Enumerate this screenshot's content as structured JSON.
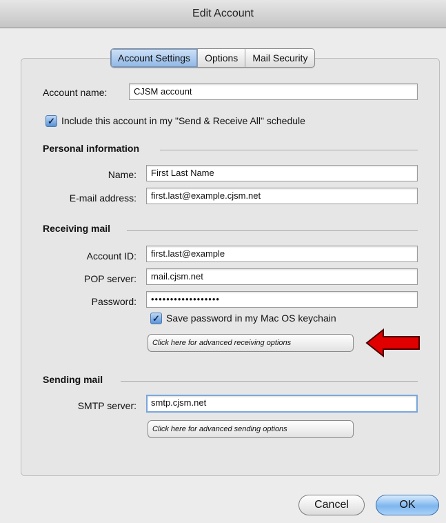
{
  "window": {
    "title": "Edit Account"
  },
  "tabs": [
    {
      "label": "Account Settings",
      "active": true
    },
    {
      "label": "Options",
      "active": false
    },
    {
      "label": "Mail Security",
      "active": false
    }
  ],
  "account": {
    "name_label": "Account name:",
    "name_value": "CJSM account",
    "include_checkbox_label": "Include this account in my \"Send & Receive All\" schedule",
    "include_checked": true
  },
  "personal": {
    "heading": "Personal information",
    "name_label": "Name:",
    "name_value": "First Last Name",
    "email_label": "E-mail address:",
    "email_value": "first.last@example.cjsm.net"
  },
  "receiving": {
    "heading": "Receiving mail",
    "account_id_label": "Account ID:",
    "account_id_value": "first.last@example",
    "pop_label": "POP server:",
    "pop_value": "mail.cjsm.net",
    "password_label": "Password:",
    "password_value": "••••••••••••••••••",
    "save_password_label": "Save password in my Mac OS keychain",
    "save_password_checked": true,
    "advanced_button": "Click here for advanced receiving options"
  },
  "sending": {
    "heading": "Sending mail",
    "smtp_label": "SMTP server:",
    "smtp_value": "smtp.cjsm.net",
    "advanced_button": "Click here for advanced sending options"
  },
  "footer": {
    "cancel_label": "Cancel",
    "ok_label": "OK"
  },
  "colors": {
    "arrow": "#e00000",
    "accent": "#7aa7dc"
  },
  "icons": {
    "checkmark": "checkmark-icon",
    "arrow": "red-arrow-icon"
  }
}
